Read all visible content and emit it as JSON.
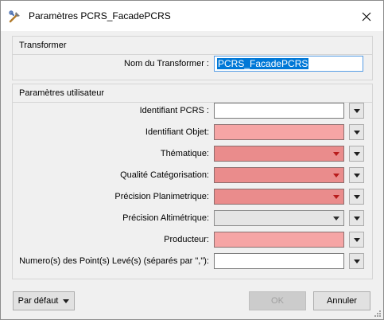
{
  "window": {
    "title": "Paramètres PCRS_FacadePCRS"
  },
  "transformer": {
    "group_title": "Transformer",
    "name_label": "Nom du Transformer :",
    "name_value": "PCRS_FacadePCRS"
  },
  "user_params": {
    "group_title": "Paramètres utilisateur",
    "rows": [
      {
        "label": "Identifiant PCRS :",
        "kind": "text",
        "required": false,
        "value": ""
      },
      {
        "label": "Identifiant Objet:",
        "kind": "text",
        "required": true,
        "value": ""
      },
      {
        "label": "Thématique:",
        "kind": "combo",
        "required": true,
        "value": ""
      },
      {
        "label": "Qualité Catégorisation:",
        "kind": "combo",
        "required": true,
        "value": ""
      },
      {
        "label": "Précision Planimetrique:",
        "kind": "combo",
        "required": true,
        "value": ""
      },
      {
        "label": "Précision Altimétrique:",
        "kind": "combo",
        "required": false,
        "value": ""
      },
      {
        "label": "Producteur:",
        "kind": "text",
        "required": true,
        "value": ""
      },
      {
        "label": "Numero(s) des Point(s) Levé(s) (séparés par \",\"):",
        "kind": "text",
        "required": false,
        "value": ""
      }
    ]
  },
  "footer": {
    "default_button": "Par défaut",
    "ok_button": "OK",
    "cancel_button": "Annuler"
  },
  "colors": {
    "required_field": "#f6a5a5",
    "required_combo": "#ea8c8c",
    "selection": "#0078d7"
  }
}
